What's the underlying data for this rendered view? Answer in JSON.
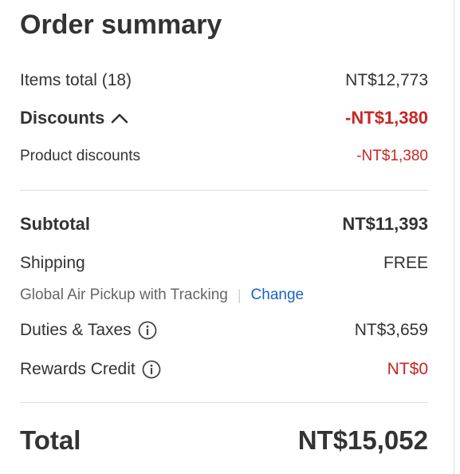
{
  "summary": {
    "title": "Order summary",
    "items_total_label": "Items total (18)",
    "items_total_value": "NT$12,773",
    "discounts_label": "Discounts",
    "discounts_value": "-NT$1,380",
    "product_discounts_label": "Product discounts",
    "product_discounts_value": "-NT$1,380",
    "subtotal_label": "Subtotal",
    "subtotal_value": "NT$11,393",
    "shipping_label": "Shipping",
    "shipping_value": "FREE",
    "shipping_method": "Global Air Pickup with Tracking",
    "shipping_separator": "|",
    "change_link": "Change",
    "duties_label": "Duties & Taxes",
    "duties_value": "NT$3,659",
    "rewards_label": "Rewards Credit",
    "rewards_value": "NT$0",
    "total_label": "Total",
    "total_value": "NT$15,052"
  },
  "icons": {
    "discounts_toggle": "chevron-up-icon",
    "duties_info": "info-icon",
    "rewards_info": "info-icon"
  },
  "colors": {
    "text": "#333333",
    "muted": "#666666",
    "discount_red": "#c62828",
    "link_blue": "#1565c0",
    "divider": "#dddddd"
  }
}
